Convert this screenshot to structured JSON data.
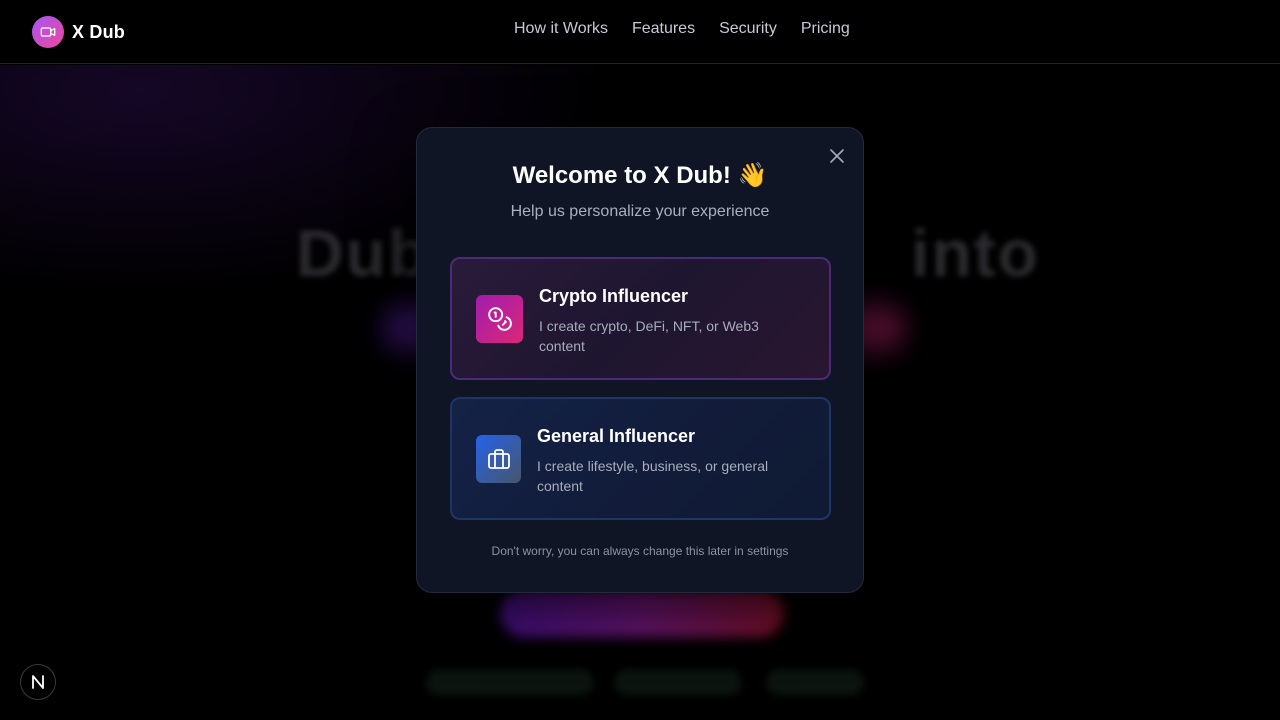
{
  "nav": {
    "brand_name": "X Dub",
    "brand_icon": "video-camera-icon",
    "links": [
      "How it Works",
      "Features",
      "Security",
      "Pricing"
    ]
  },
  "hero": {
    "title_left": "Dub",
    "title_right": "into"
  },
  "modal": {
    "title": "Welcome to X Dub! 👋",
    "subtitle": "Help us personalize your experience",
    "options": [
      {
        "title": "Crypto Influencer",
        "description": "I create crypto, DeFi, NFT, or Web3 content",
        "icon": "coins-icon"
      },
      {
        "title": "General Influencer",
        "description": "I create lifestyle, business, or general content",
        "icon": "briefcase-icon"
      }
    ],
    "note": "Don't worry, you can always change this later in settings"
  },
  "badge": {
    "letter": "N"
  },
  "colors": {
    "brand_gradient_start": "#a855f7",
    "brand_gradient_end": "#ec4899",
    "modal_bg": "#0f1524",
    "crypto_border": "#4c2a7a",
    "general_border": "#1e3566"
  }
}
